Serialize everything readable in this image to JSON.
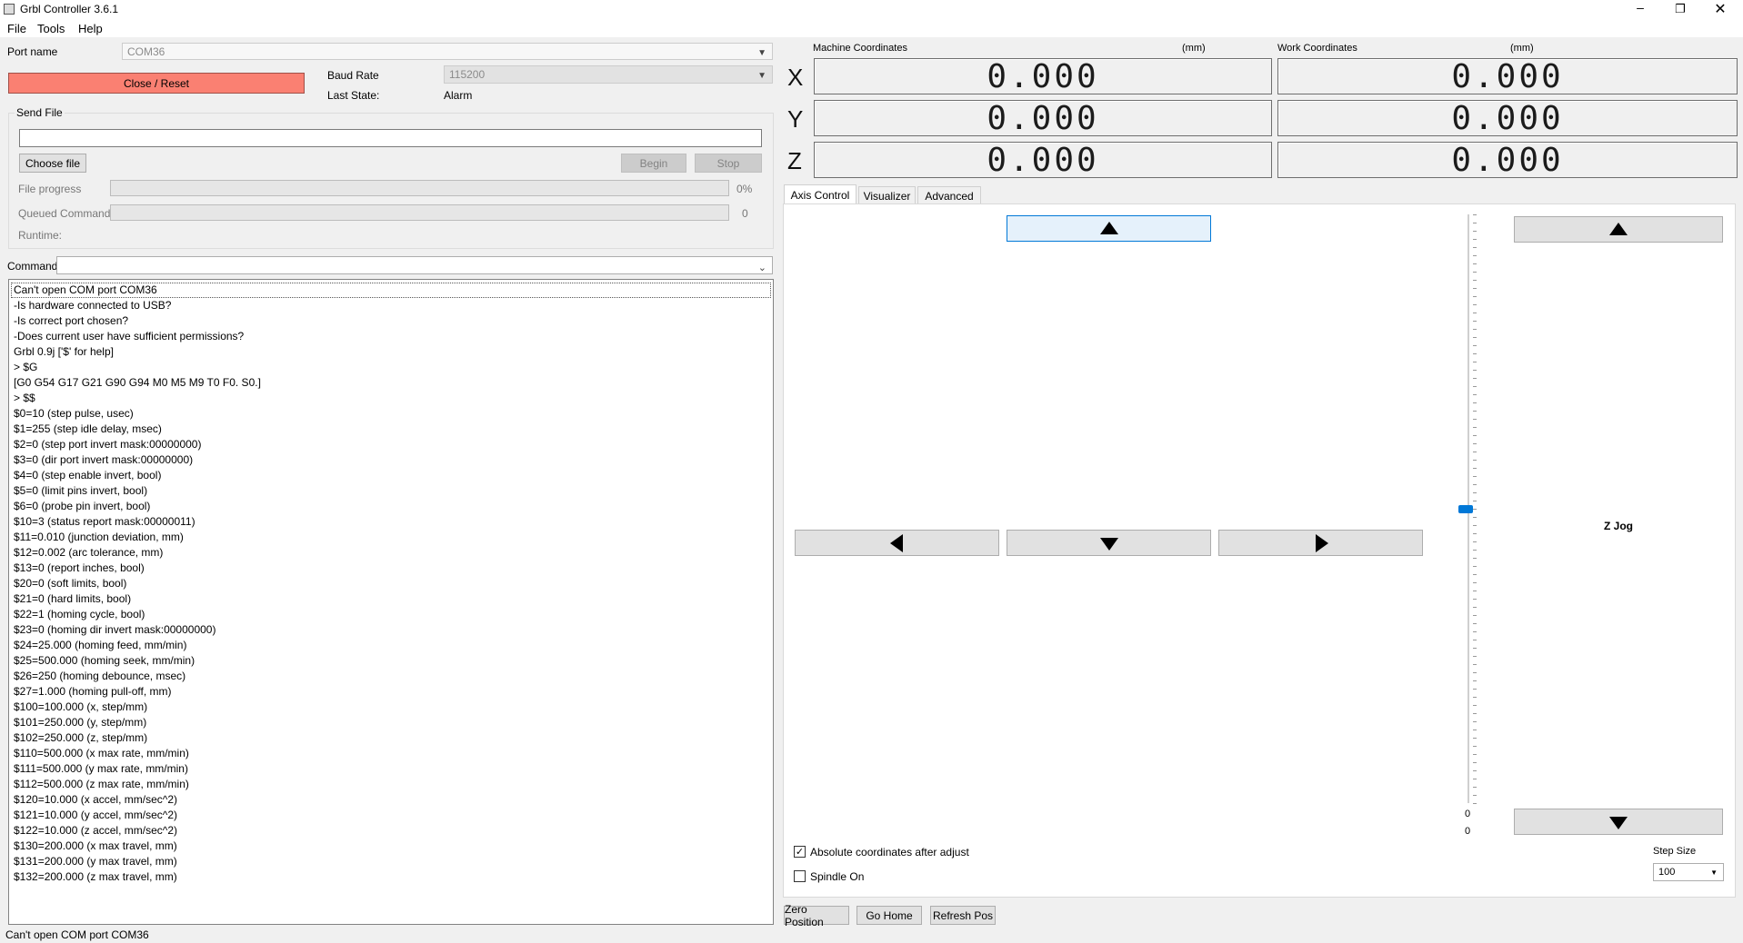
{
  "window": {
    "title": "Grbl Controller 3.6.1"
  },
  "menu": [
    "File",
    "Tools",
    "Help"
  ],
  "port": {
    "label": "Port name",
    "value": "COM36"
  },
  "close_reset_label": "Close / Reset",
  "baud": {
    "label": "Baud Rate",
    "value": "115200"
  },
  "last_state": {
    "label": "Last State:",
    "value": "Alarm"
  },
  "send_file": {
    "title": "Send File",
    "path_value": "",
    "choose_label": "Choose file",
    "begin_label": "Begin",
    "stop_label": "Stop",
    "file_progress_label": "File progress",
    "file_progress_value": "0%",
    "queued_label": "Queued Commands",
    "queued_value": "0",
    "runtime_label": "Runtime:"
  },
  "command_label": "Command",
  "console": [
    "Can't open COM port COM36",
    "-Is hardware connected to USB?",
    "-Is correct port chosen?",
    "-Does current user have sufficient permissions?",
    "Grbl 0.9j ['$' for help]",
    "> $G",
    "[G0 G54 G17 G21 G90 G94 M0 M5 M9 T0 F0. S0.]",
    "> $$",
    "$0=10 (step pulse, usec)",
    "$1=255 (step idle delay, msec)",
    "$2=0 (step port invert mask:00000000)",
    "$3=0 (dir port invert mask:00000000)",
    "$4=0 (step enable invert, bool)",
    "$5=0 (limit pins invert, bool)",
    "$6=0 (probe pin invert, bool)",
    "$10=3 (status report mask:00000011)",
    "$11=0.010 (junction deviation, mm)",
    "$12=0.002 (arc tolerance, mm)",
    "$13=0 (report inches, bool)",
    "$20=0 (soft limits, bool)",
    "$21=0 (hard limits, bool)",
    "$22=1 (homing cycle, bool)",
    "$23=0 (homing dir invert mask:00000000)",
    "$24=25.000 (homing feed, mm/min)",
    "$25=500.000 (homing seek, mm/min)",
    "$26=250 (homing debounce, msec)",
    "$27=1.000 (homing pull-off, mm)",
    "$100=100.000 (x, step/mm)",
    "$101=250.000 (y, step/mm)",
    "$102=250.000 (z, step/mm)",
    "$110=500.000 (x max rate, mm/min)",
    "$111=500.000 (y max rate, mm/min)",
    "$112=500.000 (z max rate, mm/min)",
    "$120=10.000 (x accel, mm/sec^2)",
    "$121=10.000 (y accel, mm/sec^2)",
    "$122=10.000 (z accel, mm/sec^2)",
    "$130=200.000 (x max travel, mm)",
    "$131=200.000 (y max travel, mm)",
    "$132=200.000 (z max travel, mm)"
  ],
  "status_bar": "Can't open COM port COM36",
  "coords": {
    "machine_label": "Machine Coordinates",
    "work_label": "Work Coordinates",
    "unit": "(mm)",
    "axes": [
      {
        "axis": "X",
        "machine": "0.000",
        "work": "0.000"
      },
      {
        "axis": "Y",
        "machine": "0.000",
        "work": "0.000"
      },
      {
        "axis": "Z",
        "machine": "0.000",
        "work": "0.000"
      }
    ]
  },
  "tabs": [
    "Axis Control",
    "Visualizer",
    "Advanced"
  ],
  "active_tab": "Axis Control",
  "jog": {
    "z_jog_label": "Z Jog",
    "slider_value_top": "0",
    "slider_value_bottom": "0",
    "slider_level": 0.5
  },
  "absolute_coords": {
    "label": "Absolute coordinates after adjust",
    "checked": true
  },
  "spindle_on": {
    "label": "Spindle On",
    "checked": false
  },
  "step_size": {
    "label": "Step Size",
    "value": "100"
  },
  "bottom_buttons": [
    "Zero Position",
    "Go Home",
    "Refresh Pos"
  ],
  "colors": {
    "close_reset_bg": "#fa8072",
    "jog_highlight": "#e5f1fb",
    "slider_handle": "#0078d7"
  }
}
